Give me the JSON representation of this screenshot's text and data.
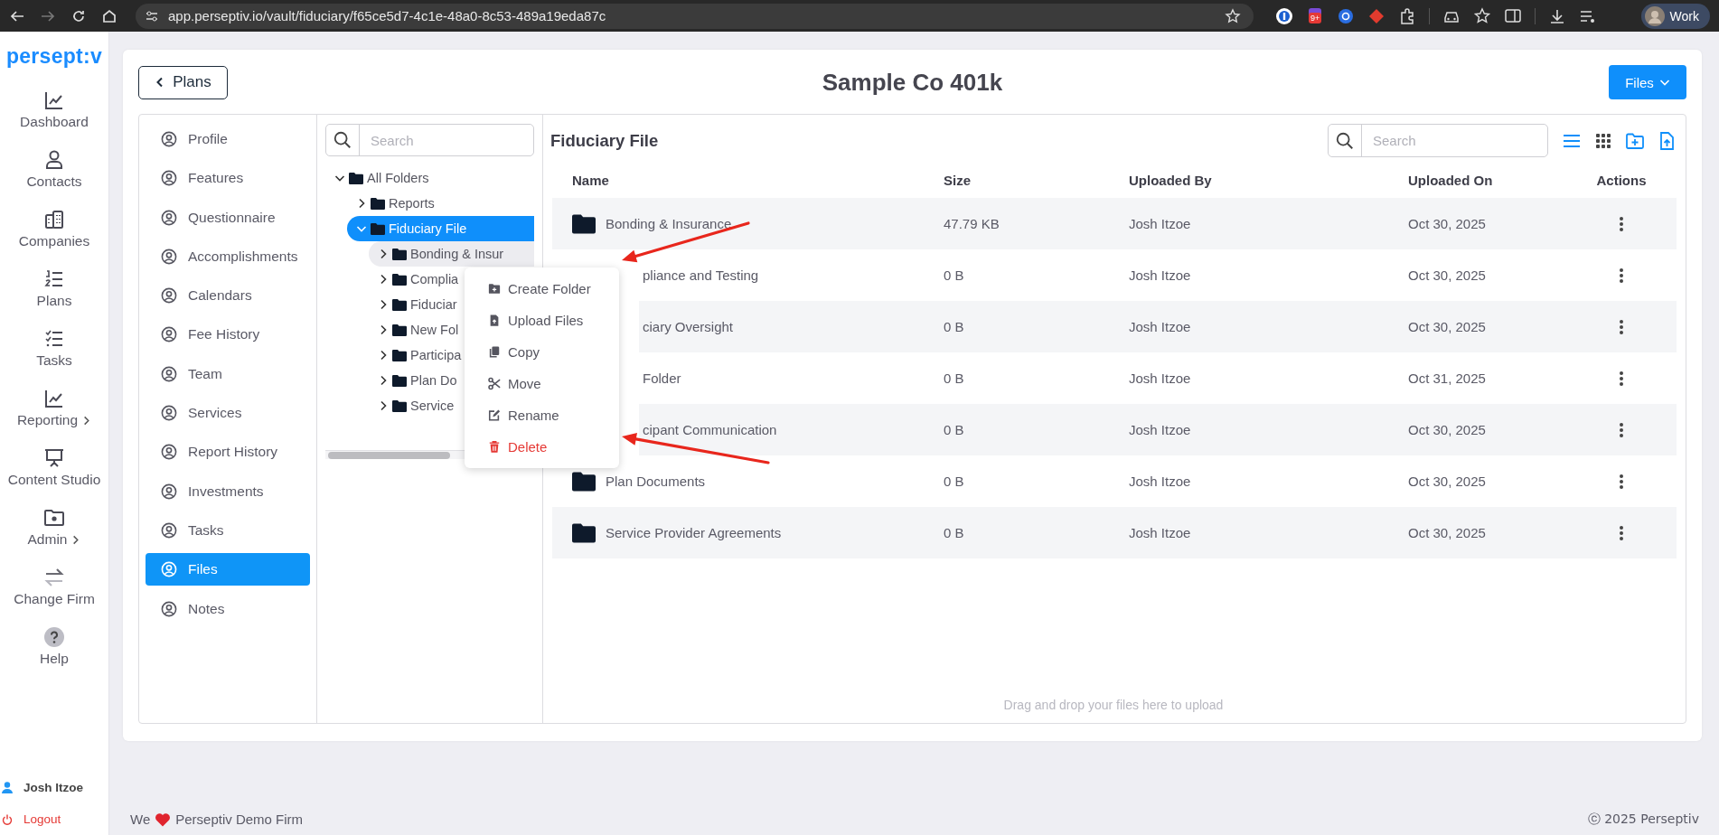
{
  "browser": {
    "url": "app.perseptiv.io/vault/fiduciary/f65ce5d7-4c1e-48a0-8c53-489a19eda87c",
    "extension_badge": "9+",
    "profile": "Work"
  },
  "app_nav": {
    "logo": "persept:v",
    "items": [
      {
        "label": "Dashboard",
        "has_submenu": false
      },
      {
        "label": "Contacts",
        "has_submenu": false
      },
      {
        "label": "Companies",
        "has_submenu": false
      },
      {
        "label": "Plans",
        "has_submenu": false
      },
      {
        "label": "Tasks",
        "has_submenu": false
      },
      {
        "label": "Reporting",
        "has_submenu": true
      },
      {
        "label": "Content Studio",
        "has_submenu": false
      },
      {
        "label": "Admin",
        "has_submenu": true
      },
      {
        "label": "Change Firm",
        "has_submenu": false
      },
      {
        "label": "Help",
        "has_submenu": false
      }
    ],
    "user": "Josh Itzoe",
    "logout": "Logout"
  },
  "header": {
    "back_button": "Plans",
    "title": "Sample Co 401k",
    "menu_button": "Files"
  },
  "plan_menu": {
    "items": [
      {
        "label": "Profile",
        "selected": false
      },
      {
        "label": "Features",
        "selected": false
      },
      {
        "label": "Questionnaire",
        "selected": false
      },
      {
        "label": "Accomplishments",
        "selected": false
      },
      {
        "label": "Calendars",
        "selected": false
      },
      {
        "label": "Fee History",
        "selected": false
      },
      {
        "label": "Team",
        "selected": false
      },
      {
        "label": "Services",
        "selected": false
      },
      {
        "label": "Report History",
        "selected": false
      },
      {
        "label": "Investments",
        "selected": false
      },
      {
        "label": "Tasks",
        "selected": false
      },
      {
        "label": "Files",
        "selected": true
      },
      {
        "label": "Notes",
        "selected": false
      }
    ]
  },
  "folder_tree": {
    "search": {
      "placeholder": "Search"
    },
    "items": [
      {
        "label": "All Folders",
        "expanded": true,
        "selected": false,
        "hovered": false,
        "children": [
          {
            "label": "Reports",
            "expanded": false,
            "selected": false,
            "hovered": false
          },
          {
            "label": "Fiduciary File",
            "expanded": true,
            "selected": true,
            "hovered": false,
            "children": [
              {
                "label": "Bonding & Insur",
                "expanded": false,
                "selected": false,
                "hovered": true
              },
              {
                "label": "Complia",
                "expanded": false,
                "selected": false,
                "hovered": false
              },
              {
                "label": "Fiduciar",
                "expanded": false,
                "selected": false,
                "hovered": false
              },
              {
                "label": "New Fol",
                "expanded": false,
                "selected": false,
                "hovered": false
              },
              {
                "label": "Participa",
                "expanded": false,
                "selected": false,
                "hovered": false
              },
              {
                "label": "Plan Do",
                "expanded": false,
                "selected": false,
                "hovered": false
              },
              {
                "label": "Service",
                "expanded": false,
                "selected": false,
                "hovered": false
              }
            ]
          }
        ]
      }
    ]
  },
  "files": {
    "title": "Fiduciary File",
    "search": {
      "placeholder": "Search"
    },
    "table": {
      "columns": [
        "Name",
        "Size",
        "Uploaded By",
        "Uploaded On",
        "Actions"
      ],
      "rows": [
        {
          "name": "Bonding & Insurance",
          "size": "47.79 KB",
          "uploaded_by": "Josh Itzoe",
          "uploaded_on": "Oct 30, 2025",
          "covered": false
        },
        {
          "name": "pliance and Testing",
          "size": "0 B",
          "uploaded_by": "Josh Itzoe",
          "uploaded_on": "Oct 30, 2025",
          "covered": true
        },
        {
          "name": "ciary Oversight",
          "size": "0 B",
          "uploaded_by": "Josh Itzoe",
          "uploaded_on": "Oct 30, 2025",
          "covered": true
        },
        {
          "name": "Folder",
          "size": "0 B",
          "uploaded_by": "Josh Itzoe",
          "uploaded_on": "Oct 31, 2025",
          "covered": true
        },
        {
          "name": "cipant Communication",
          "size": "0 B",
          "uploaded_by": "Josh Itzoe",
          "uploaded_on": "Oct 30, 2025",
          "covered": true
        },
        {
          "name": "Plan Documents",
          "size": "0 B",
          "uploaded_by": "Josh Itzoe",
          "uploaded_on": "Oct 30, 2025",
          "covered": false
        },
        {
          "name": "Service Provider Agreements",
          "size": "0 B",
          "uploaded_by": "Josh Itzoe",
          "uploaded_on": "Oct 30, 2025",
          "covered": false
        }
      ]
    },
    "drop_hint": "Drag and drop your files here to upload"
  },
  "context_menu": {
    "items": [
      {
        "label": "Create Folder",
        "kind": "normal"
      },
      {
        "label": "Upload Files",
        "kind": "normal"
      },
      {
        "label": "Copy",
        "kind": "normal"
      },
      {
        "label": "Move",
        "kind": "normal"
      },
      {
        "label": "Rename",
        "kind": "normal"
      },
      {
        "label": "Delete",
        "kind": "danger"
      }
    ]
  },
  "footer": {
    "left_prefix": "We",
    "left_text": "Perseptiv Demo Firm",
    "right": "ⓒ 2025 Perseptiv"
  }
}
